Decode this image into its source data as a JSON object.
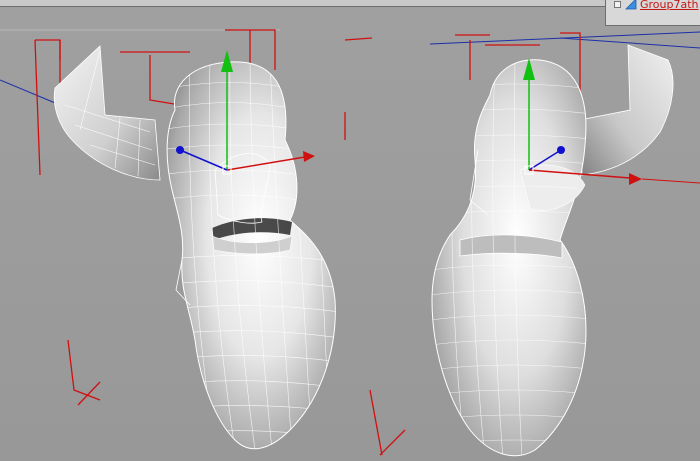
{
  "outliner": {
    "group_label": "Group7ath",
    "icons": [
      "expand-collapse-icon",
      "group-node-icon"
    ]
  },
  "colors": {
    "viewport_bg": "#9c9c9c",
    "wireframe": "#ffffff",
    "axis_x": "#d01010",
    "axis_y": "#11c011",
    "axis_z": "#1010d0",
    "pivot_box": "#e01010"
  }
}
